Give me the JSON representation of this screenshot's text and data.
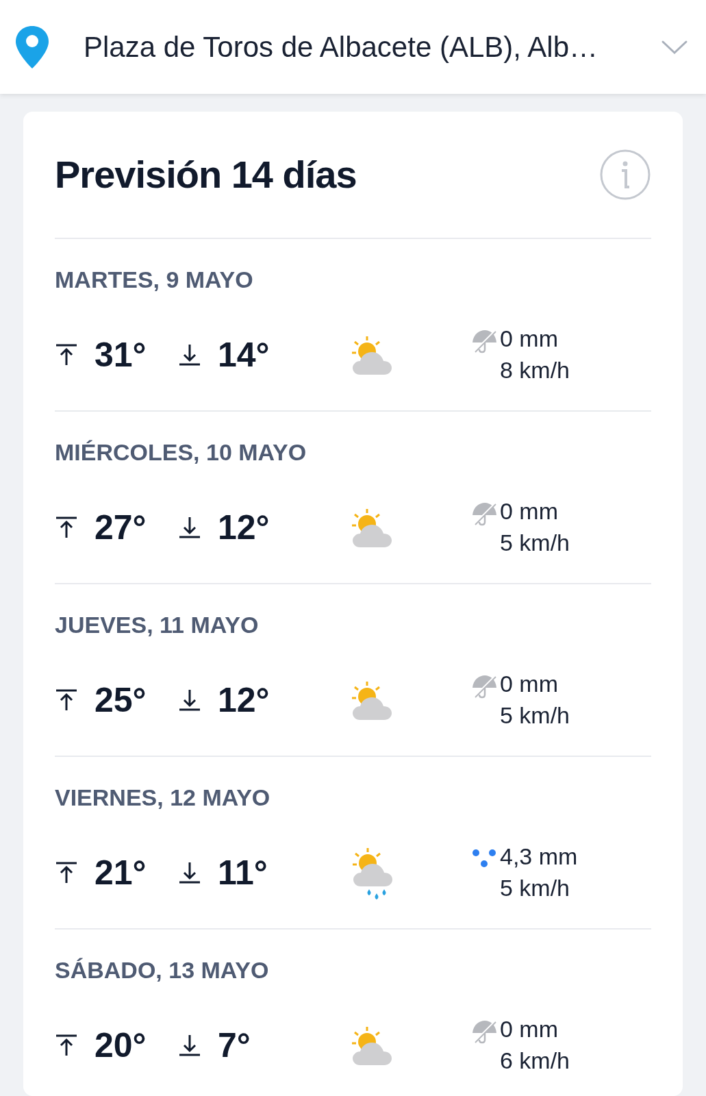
{
  "location": {
    "name": "Plaza de Toros de Albacete (ALB), Alb…"
  },
  "forecast": {
    "title": "Previsión 14 días",
    "days": [
      {
        "date": "MARTES, 9 MAYO",
        "max": "31°",
        "min": "14°",
        "sky": {
          "kind": "partly-cloudy"
        },
        "precipitation": {
          "kind": "dry",
          "amount": "0 mm"
        },
        "wind": "8 km/h"
      },
      {
        "date": "MIÉRCOLES, 10 MAYO",
        "max": "27°",
        "min": "12°",
        "sky": {
          "kind": "partly-cloudy"
        },
        "precipitation": {
          "kind": "dry",
          "amount": "0 mm"
        },
        "wind": "5 km/h"
      },
      {
        "date": "JUEVES, 11 MAYO",
        "max": "25°",
        "min": "12°",
        "sky": {
          "kind": "partly-cloudy"
        },
        "precipitation": {
          "kind": "dry",
          "amount": "0 mm"
        },
        "wind": "5 km/h"
      },
      {
        "date": "VIERNES, 12 MAYO",
        "max": "21°",
        "min": "11°",
        "sky": {
          "kind": "rain"
        },
        "precipitation": {
          "kind": "rain",
          "amount": "4,3 mm"
        },
        "wind": "5 km/h"
      },
      {
        "date": "SÁBADO, 13 MAYO",
        "max": "20°",
        "min": "7°",
        "sky": {
          "kind": "partly-cloudy"
        },
        "precipitation": {
          "kind": "dry",
          "amount": "0 mm"
        },
        "wind": "6 km/h"
      }
    ]
  }
}
